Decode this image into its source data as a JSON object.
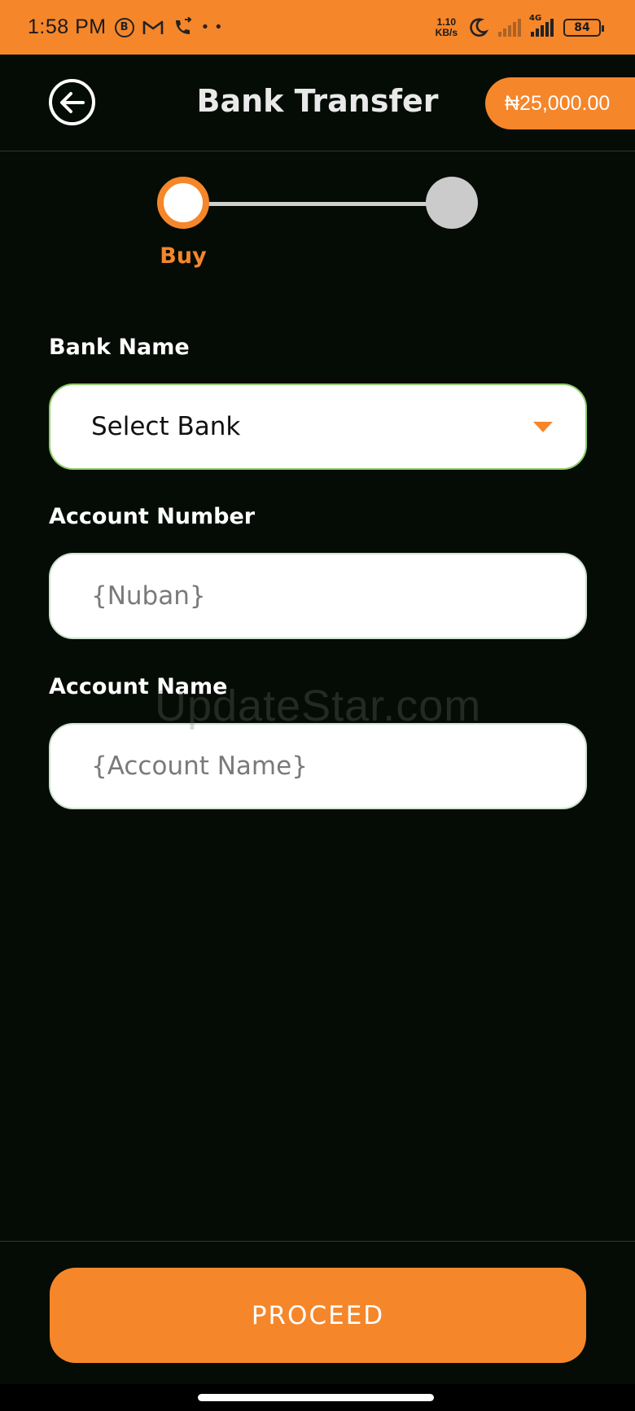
{
  "status_bar": {
    "time": "1:58 PM",
    "speed_value": "1.10",
    "speed_unit": "KB/s",
    "network": "4G",
    "battery": "84"
  },
  "header": {
    "title": "Bank Transfer",
    "balance": "₦25,000.00"
  },
  "stepper": {
    "step1_label": "Buy"
  },
  "form": {
    "bank_label": "Bank Name",
    "bank_value": "Select Bank",
    "account_number_label": "Account Number",
    "account_number_placeholder": "{Nuban}",
    "account_name_label": "Account Name",
    "account_name_placeholder": "{Account Name}"
  },
  "watermark": "UpdateStar.com",
  "actions": {
    "proceed_label": "PROCEED"
  },
  "colors": {
    "accent": "#f5862a",
    "background": "#050c05",
    "field": "#ffffff"
  }
}
